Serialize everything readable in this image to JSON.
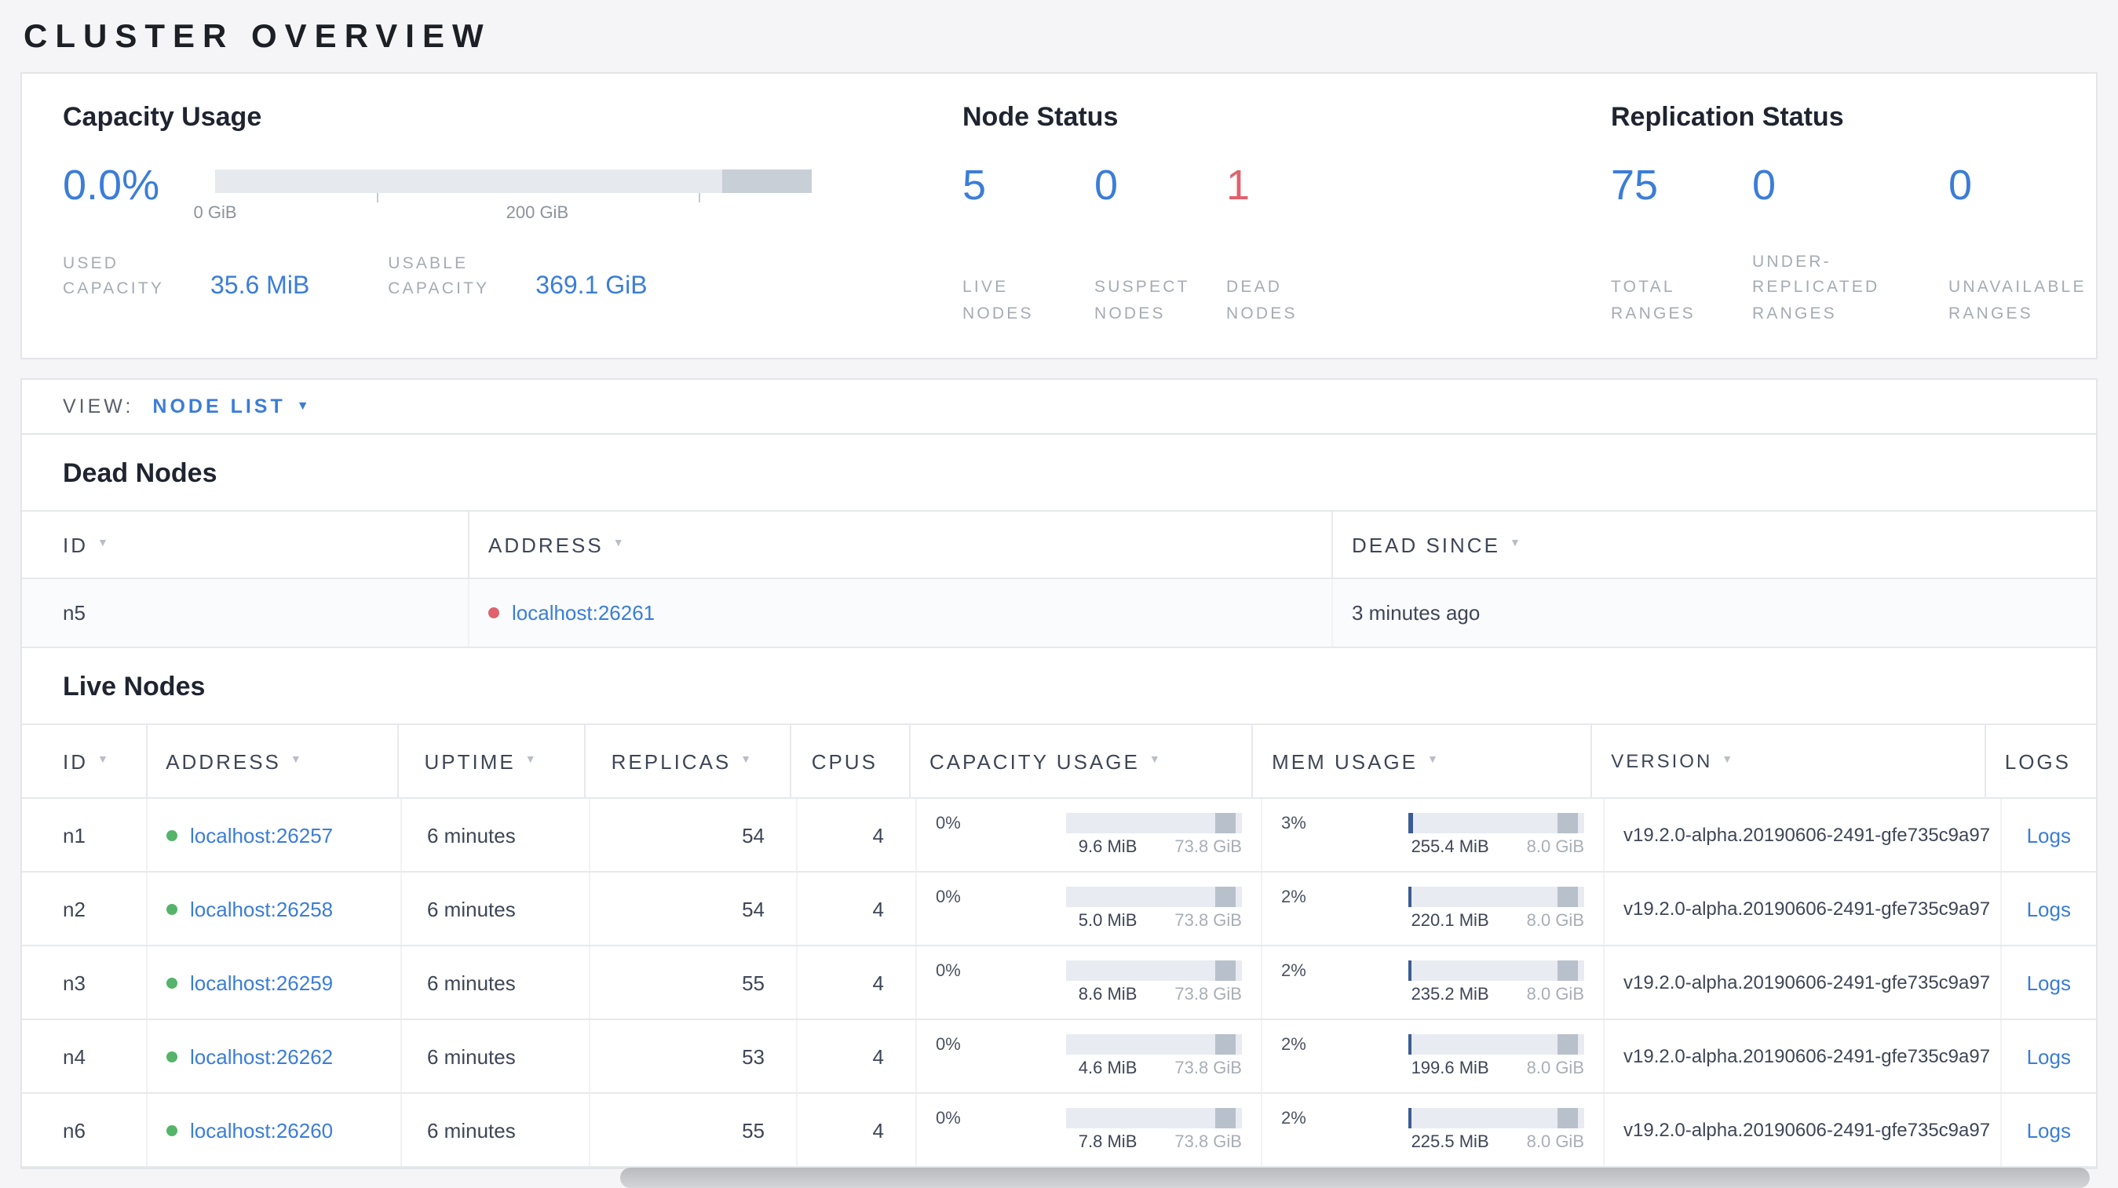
{
  "colors": {
    "accent_blue": "#3b7dd8",
    "danger_red": "#e0626d",
    "live_green": "#55b36a",
    "dead_red": "#e0626d"
  },
  "icons": {
    "sort_arrow": "▼",
    "caret_down": "▼"
  },
  "page": {
    "title": "CLUSTER OVERVIEW"
  },
  "capacity": {
    "title": "Capacity Usage",
    "percent": "0.0%",
    "axis": {
      "tick0_label": "0 GiB",
      "tick200_label": "200 GiB"
    },
    "used": {
      "label": "USED CAPACITY",
      "value": "35.6 MiB"
    },
    "usable": {
      "label": "USABLE CAPACITY",
      "value": "369.1 GiB"
    }
  },
  "node_status": {
    "title": "Node Status",
    "stats": [
      {
        "value": "5",
        "label": "LIVE NODES",
        "color": "blue"
      },
      {
        "value": "0",
        "label": "SUSPECT NODES",
        "color": "blue"
      },
      {
        "value": "1",
        "label": "DEAD NODES",
        "color": "red"
      }
    ]
  },
  "replication": {
    "title": "Replication Status",
    "stats": [
      {
        "value": "75",
        "label": "TOTAL RANGES",
        "color": "blue"
      },
      {
        "value": "0",
        "label": "UNDER-REPLICATED RANGES",
        "color": "blue"
      },
      {
        "value": "0",
        "label": "UNAVAILABLE RANGES",
        "color": "blue"
      }
    ]
  },
  "view_bar": {
    "label": "VIEW:",
    "selected": "NODE LIST"
  },
  "dead_nodes": {
    "title": "Dead Nodes",
    "columns": {
      "id": "ID",
      "address": "ADDRESS",
      "dead_since": "DEAD SINCE"
    },
    "rows": [
      {
        "id": "n5",
        "address": "localhost:26261",
        "dead_since": "3 minutes ago"
      }
    ]
  },
  "live_nodes": {
    "title": "Live Nodes",
    "columns": {
      "id": "ID",
      "address": "ADDRESS",
      "uptime": "UPTIME",
      "replicas": "REPLICAS",
      "cpus": "CPUS",
      "capacity": "CAPACITY USAGE",
      "mem": "MEM USAGE",
      "version": "VERSION",
      "logs": "LOGS"
    },
    "rows": [
      {
        "id": "n1",
        "address": "localhost:26257",
        "uptime": "6 minutes",
        "replicas": "54",
        "cpus": "4",
        "capacity": {
          "percent": "0%",
          "frac": 0,
          "used": "9.6 MiB",
          "total": "73.8 GiB"
        },
        "mem": {
          "percent": "3%",
          "frac": 0.03,
          "used": "255.4 MiB",
          "total": "8.0 GiB"
        },
        "version": "v19.2.0-alpha.20190606-2491-gfe735c9a97",
        "logs_label": "Logs"
      },
      {
        "id": "n2",
        "address": "localhost:26258",
        "uptime": "6 minutes",
        "replicas": "54",
        "cpus": "4",
        "capacity": {
          "percent": "0%",
          "frac": 0,
          "used": "5.0 MiB",
          "total": "73.8 GiB"
        },
        "mem": {
          "percent": "2%",
          "frac": 0.02,
          "used": "220.1 MiB",
          "total": "8.0 GiB"
        },
        "version": "v19.2.0-alpha.20190606-2491-gfe735c9a97",
        "logs_label": "Logs"
      },
      {
        "id": "n3",
        "address": "localhost:26259",
        "uptime": "6 minutes",
        "replicas": "55",
        "cpus": "4",
        "capacity": {
          "percent": "0%",
          "frac": 0,
          "used": "8.6 MiB",
          "total": "73.8 GiB"
        },
        "mem": {
          "percent": "2%",
          "frac": 0.02,
          "used": "235.2 MiB",
          "total": "8.0 GiB"
        },
        "version": "v19.2.0-alpha.20190606-2491-gfe735c9a97",
        "logs_label": "Logs"
      },
      {
        "id": "n4",
        "address": "localhost:26262",
        "uptime": "6 minutes",
        "replicas": "53",
        "cpus": "4",
        "capacity": {
          "percent": "0%",
          "frac": 0,
          "used": "4.6 MiB",
          "total": "73.8 GiB"
        },
        "mem": {
          "percent": "2%",
          "frac": 0.02,
          "used": "199.6 MiB",
          "total": "8.0 GiB"
        },
        "version": "v19.2.0-alpha.20190606-2491-gfe735c9a97",
        "logs_label": "Logs"
      },
      {
        "id": "n6",
        "address": "localhost:26260",
        "uptime": "6 minutes",
        "replicas": "55",
        "cpus": "4",
        "capacity": {
          "percent": "0%",
          "frac": 0,
          "used": "7.8 MiB",
          "total": "73.8 GiB"
        },
        "mem": {
          "percent": "2%",
          "frac": 0.02,
          "used": "225.5 MiB",
          "total": "8.0 GiB"
        },
        "version": "v19.2.0-alpha.20190606-2491-gfe735c9a97",
        "logs_label": "Logs"
      }
    ]
  }
}
